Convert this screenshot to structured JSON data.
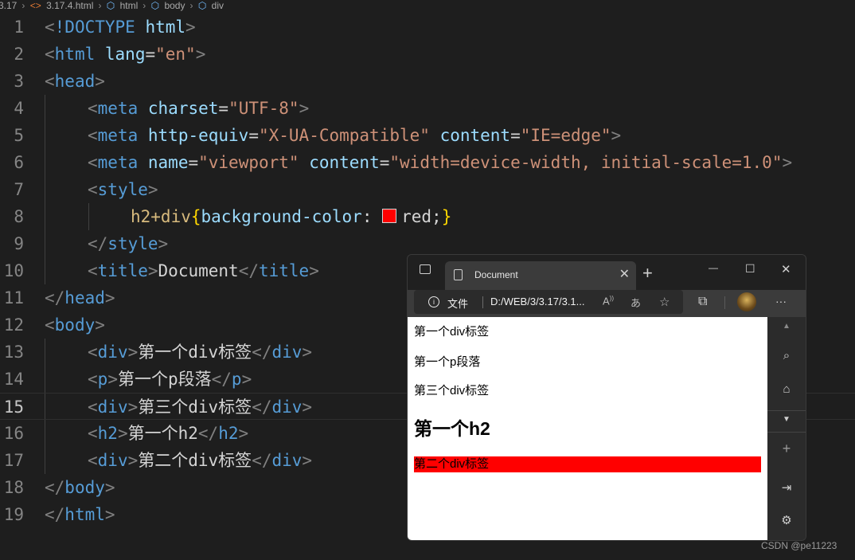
{
  "breadcrumb": {
    "items": [
      "3.17",
      "3.17.4.html",
      "html",
      "body",
      "div"
    ]
  },
  "editor": {
    "current_line": "15",
    "lines": [
      {
        "n": "1"
      },
      {
        "n": "2"
      },
      {
        "n": "3"
      },
      {
        "n": "4"
      },
      {
        "n": "5"
      },
      {
        "n": "6"
      },
      {
        "n": "7"
      },
      {
        "n": "8"
      },
      {
        "n": "9"
      },
      {
        "n": "10"
      },
      {
        "n": "11"
      },
      {
        "n": "12"
      },
      {
        "n": "13"
      },
      {
        "n": "14"
      },
      {
        "n": "15"
      },
      {
        "n": "16"
      },
      {
        "n": "17"
      },
      {
        "n": "18"
      },
      {
        "n": "19"
      }
    ],
    "code": {
      "l1": {
        "p1": "<",
        "p2": "!DOCTYPE",
        "p3": " ",
        "p4": "html",
        "p5": ">"
      },
      "l2": {
        "tag": "html",
        "attr": "lang",
        "val": "\"en\""
      },
      "l3": {
        "tag": "head"
      },
      "l4": {
        "tag": "meta",
        "attr": "charset",
        "val": "\"UTF-8\""
      },
      "l5": {
        "tag": "meta",
        "attr1": "http-equiv",
        "val1": "\"X-UA-Compatible\"",
        "attr2": "content",
        "val2": "\"IE=edge\""
      },
      "l6": {
        "tag": "meta",
        "attr1": "name",
        "val1": "\"viewport\"",
        "attr2": "content",
        "val2": "\"width=device-width, initial-scale=1.0\""
      },
      "l7": {
        "tag": "style"
      },
      "l8": {
        "selector": "h2+div",
        "brace_open": "{",
        "prop": "background-color",
        "colon": ": ",
        "value": "red;",
        "brace_close": "}",
        "swatch_color": "#ff0000"
      },
      "l9": {
        "tag": "style"
      },
      "l10": {
        "tag": "title",
        "text": "Document"
      },
      "l11": {
        "tag": "head"
      },
      "l12": {
        "tag": "body"
      },
      "l13": {
        "tag": "div",
        "text": "第一个div标签"
      },
      "l14": {
        "tag": "p",
        "text": "第一个p段落"
      },
      "l15": {
        "tag": "div",
        "text": "第三个div标签"
      },
      "l16": {
        "tag": "h2",
        "text": "第一个h2"
      },
      "l17": {
        "tag": "div",
        "text": "第二个div标签"
      },
      "l18": {
        "tag": "body"
      },
      "l19": {
        "tag": "html"
      }
    }
  },
  "browser": {
    "tab_title": "Document",
    "new_tab": "+",
    "window_controls": {
      "minimize": "—",
      "maximize": "☐",
      "close": "✕"
    },
    "address": {
      "scheme_label": "文件",
      "url": "D:/WEB/3/3.17/3.1..."
    },
    "toolbar_more": "···",
    "page": {
      "div1": "第一个div标签",
      "p": "第一个p段落",
      "div3": "第三个div标签",
      "h2": "第一个h2",
      "div2": "第二个div标签",
      "highlight_color": "#ff0000"
    },
    "sidebar_icons": [
      "chevron-up-icon",
      "search-icon",
      "tag-icon",
      "chevron-down-icon",
      "plus-icon",
      "split-icon",
      "gear-icon"
    ]
  },
  "watermark": "CSDN @pe11223"
}
